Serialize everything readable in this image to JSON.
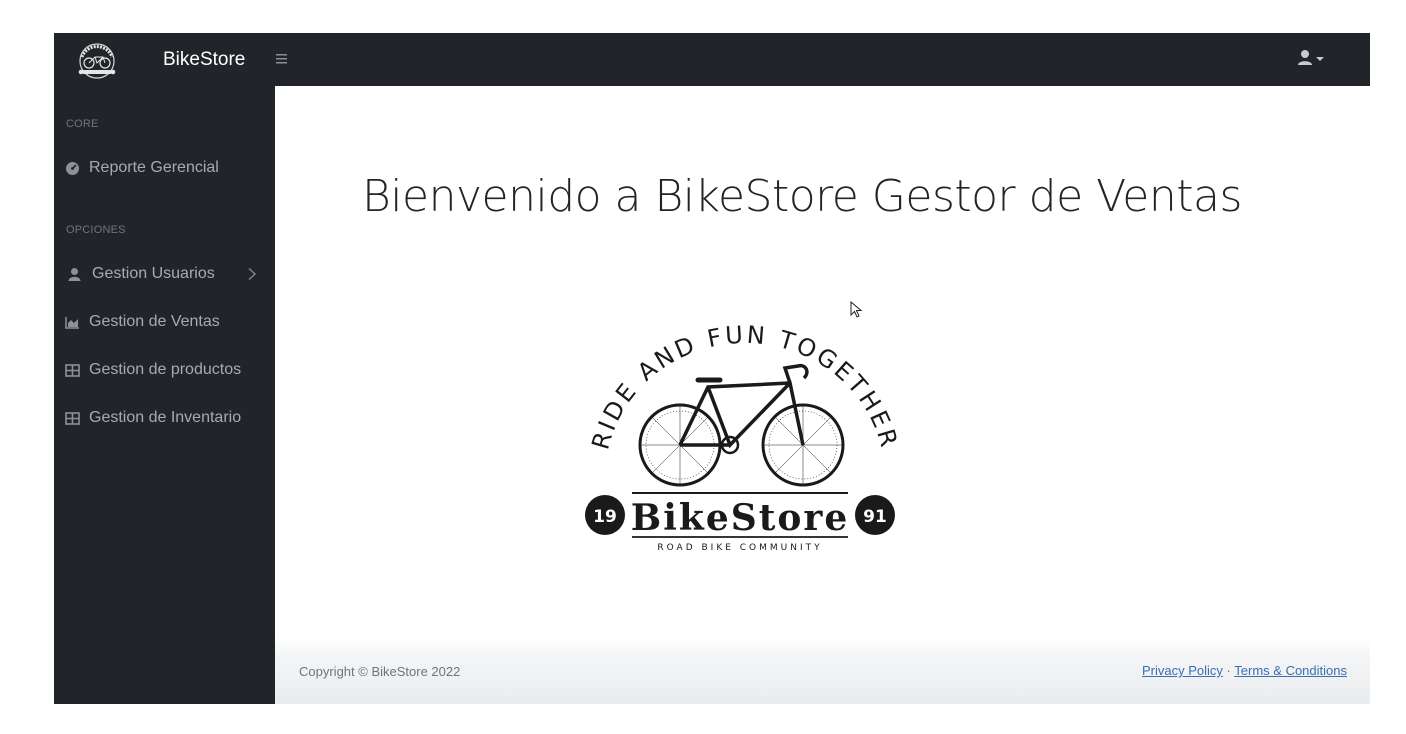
{
  "brand": {
    "name": "BikeStore",
    "logo_icon": "bikestore-logo-icon"
  },
  "topbar": {
    "toggle_icon": "hamburger-icon",
    "user_icon": "user-icon",
    "caret_icon": "caret-down-icon"
  },
  "sidebar": {
    "headings": [
      "CORE",
      "OPCIONES"
    ],
    "items": [
      {
        "label": "Reporte Gerencial",
        "icon": "dashboard-icon"
      },
      {
        "label": "Gestion Usuarios",
        "icon": "user-icon",
        "expandable": true
      },
      {
        "label": "Gestion de Ventas",
        "icon": "chart-area-icon"
      },
      {
        "label": "Gestion de productos",
        "icon": "table-icon"
      },
      {
        "label": "Gestion de Inventario",
        "icon": "table-icon"
      }
    ]
  },
  "main": {
    "title": "Bienvenido a BikeStore Gestor de Ventas",
    "logo": {
      "arc_text": "RIDE AND FUN TOGETHER",
      "year_left": "19",
      "year_right": "91",
      "name": "BikeStore",
      "tagline": "ROAD BIKE COMMUNITY"
    }
  },
  "footer": {
    "copyright": "Copyright © BikeStore 2022",
    "privacy": "Privacy Policy",
    "separator": "·",
    "terms": "Terms & Conditions"
  },
  "colors": {
    "nav_bg": "#212529",
    "link": "#3a6fb0",
    "muted": "#6c757d"
  }
}
